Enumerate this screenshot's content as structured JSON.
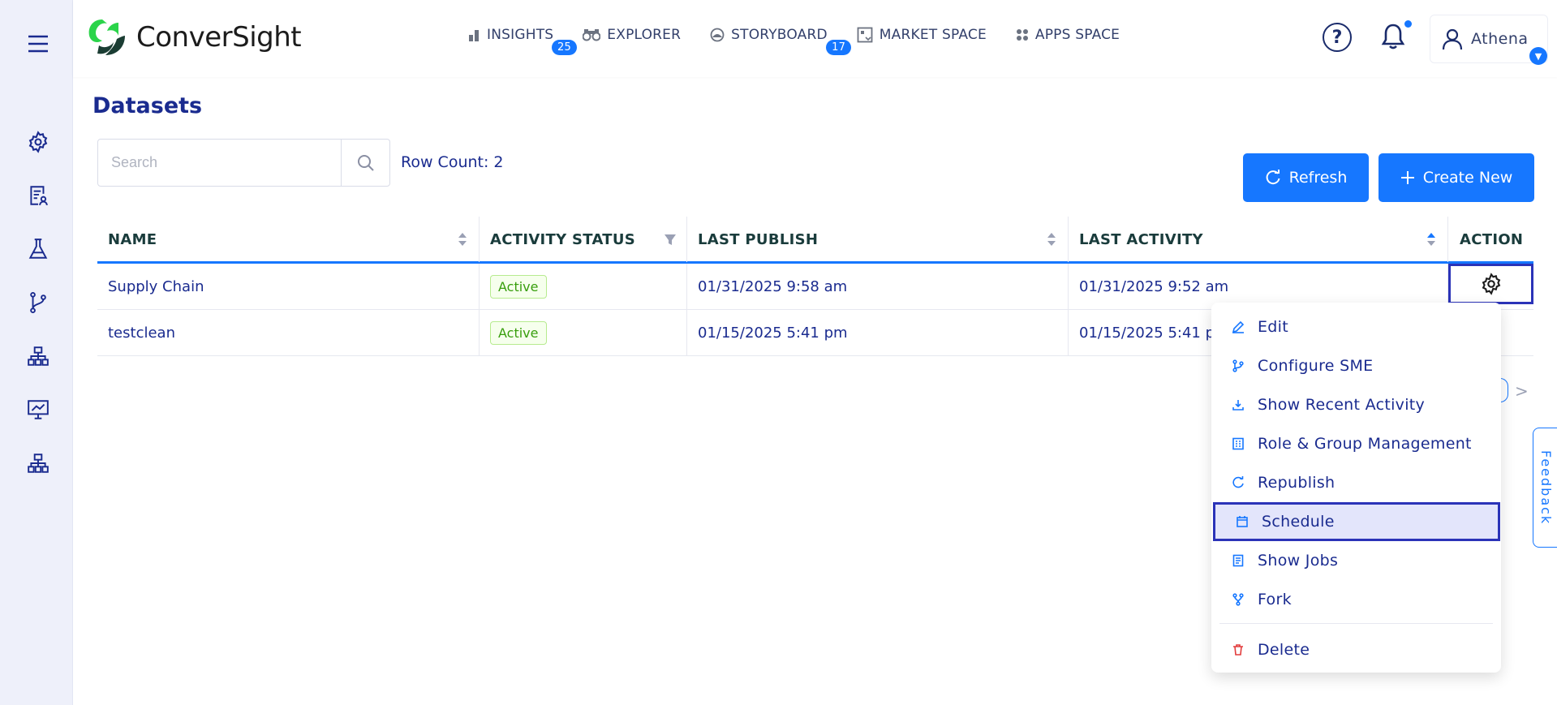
{
  "app": {
    "brand": "ConverSight"
  },
  "nav": [
    {
      "label": "INSIGHTS",
      "icon": "bar-chart-icon",
      "badge": "25"
    },
    {
      "label": "EXPLORER",
      "icon": "binoculars-icon",
      "badge": ""
    },
    {
      "label": "STORYBOARD",
      "icon": "storyboard-icon",
      "badge": "17"
    },
    {
      "label": "MARKET SPACE",
      "icon": "market-icon",
      "badge": ""
    },
    {
      "label": "APPS SPACE",
      "icon": "apps-grid-icon",
      "badge": ""
    }
  ],
  "user": {
    "name": "Athena"
  },
  "page": {
    "title": "Datasets"
  },
  "search": {
    "placeholder": "Search",
    "value": ""
  },
  "row_count": "Row Count: 2",
  "buttons": {
    "refresh": "Refresh",
    "create_new": "Create New"
  },
  "table": {
    "headers": {
      "name": "NAME",
      "activity_status": "ACTIVITY STATUS",
      "last_publish": "LAST PUBLISH",
      "last_activity": "LAST ACTIVITY",
      "action": "ACTION"
    },
    "rows": [
      {
        "name": "Supply Chain",
        "status": "Active",
        "last_publish": "01/31/2025 9:58 am",
        "last_activity": "01/31/2025 9:52 am"
      },
      {
        "name": "testclean",
        "status": "Active",
        "last_publish": "01/15/2025 5:41 pm",
        "last_activity": "01/15/2025 5:41 pm"
      }
    ]
  },
  "menu": {
    "items": [
      {
        "label": "Edit",
        "icon": "pencil-icon"
      },
      {
        "label": "Configure SME",
        "icon": "branch-icon"
      },
      {
        "label": "Show Recent Activity",
        "icon": "download-icon"
      },
      {
        "label": "Role & Group Management",
        "icon": "building-icon"
      },
      {
        "label": "Republish",
        "icon": "reload-icon"
      },
      {
        "label": "Schedule",
        "icon": "calendar-icon",
        "selected": true
      },
      {
        "label": "Show Jobs",
        "icon": "list-icon"
      },
      {
        "label": "Fork",
        "icon": "fork-icon"
      },
      {
        "label": "Delete",
        "icon": "trash-icon",
        "danger": true
      }
    ]
  },
  "feedback": "Feedback",
  "colors": {
    "primary": "#1677ff",
    "navy": "#1a2b8f",
    "selection_border": "#2b33b8",
    "danger": "#e23b3b"
  }
}
